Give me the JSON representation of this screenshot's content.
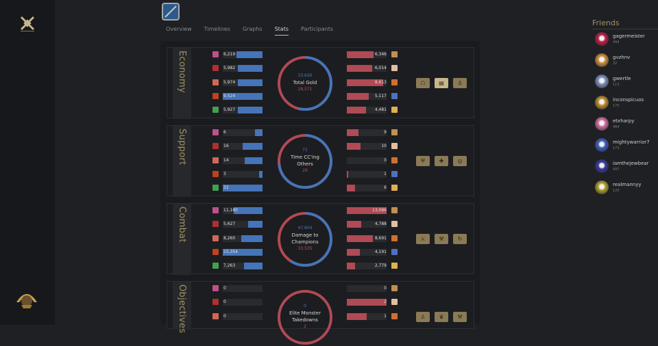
{
  "tabs": [
    {
      "label": "Overview"
    },
    {
      "label": "Timelines"
    },
    {
      "label": "Graphs"
    },
    {
      "label": "Stats",
      "active": true
    },
    {
      "label": "Participants"
    }
  ],
  "colors": {
    "blue": "#4574b8",
    "red": "#b04a55",
    "gold": "#8a7a55"
  },
  "left_champs": [
    "#c0508a",
    "#b03030",
    "#d06858",
    "#c04020",
    "#40a050"
  ],
  "right_champs": [
    "#c09050",
    "#e0c0a0",
    "#d07030",
    "#5070c0",
    "#e0b050"
  ],
  "sections": [
    {
      "name": "Economy",
      "center": {
        "blue": "33,626",
        "label1": "Total Gold",
        "label2": "",
        "red": "28,571"
      },
      "blue_frac": 0.54,
      "left": [
        {
          "value": "6,219",
          "pct": 0.65
        },
        {
          "value": "5,982",
          "pct": 0.62
        },
        {
          "value": "5,974",
          "pct": 0.62
        },
        {
          "value": "9,524",
          "pct": 1.0
        },
        {
          "value": "5,927",
          "pct": 0.62
        }
      ],
      "right": [
        {
          "value": "6,346",
          "pct": 0.68
        },
        {
          "value": "6,014",
          "pct": 0.64
        },
        {
          "value": "8,613",
          "pct": 0.92
        },
        {
          "value": "5,117",
          "pct": 0.55
        },
        {
          "value": "4,481",
          "pct": 0.48
        }
      ],
      "buttons": [
        {
          "icon": "☖",
          "on": false
        },
        {
          "icon": "▤",
          "on": true
        },
        {
          "icon": "⚓",
          "on": false
        }
      ]
    },
    {
      "name": "Support",
      "center": {
        "blue": "71",
        "label1": "Time CC'ing",
        "label2": "Others",
        "red": "26"
      },
      "blue_frac": 0.73,
      "left": [
        {
          "value": "6",
          "pct": 0.19
        },
        {
          "value": "16",
          "pct": 0.5
        },
        {
          "value": "14",
          "pct": 0.44
        },
        {
          "value": "3",
          "pct": 0.09
        },
        {
          "value": "32",
          "pct": 1.0
        }
      ],
      "right": [
        {
          "value": "9",
          "pct": 0.3
        },
        {
          "value": "10",
          "pct": 0.34
        },
        {
          "value": "0",
          "pct": 0.0
        },
        {
          "value": "1",
          "pct": 0.04
        },
        {
          "value": "6",
          "pct": 0.2
        }
      ],
      "buttons": [
        {
          "icon": "⛨",
          "on": false
        },
        {
          "icon": "✚",
          "on": false
        },
        {
          "icon": "◎",
          "on": false
        }
      ]
    },
    {
      "name": "Combat",
      "center": {
        "blue": "47,604",
        "label1": "Damage to",
        "label2": "Champions",
        "red": "33,535"
      },
      "blue_frac": 0.59,
      "left": [
        {
          "value": "11,180",
          "pct": 0.73
        },
        {
          "value": "5,627",
          "pct": 0.37
        },
        {
          "value": "8,260",
          "pct": 0.54
        },
        {
          "value": "15,354",
          "pct": 1.0
        },
        {
          "value": "7,263",
          "pct": 0.47
        }
      ],
      "right": [
        {
          "value": "13,086",
          "pct": 1.0
        },
        {
          "value": "4,788",
          "pct": 0.37
        },
        {
          "value": "8,691",
          "pct": 0.66
        },
        {
          "value": "4,191",
          "pct": 0.32
        },
        {
          "value": "2,779",
          "pct": 0.21
        }
      ],
      "buttons": [
        {
          "icon": "⚔",
          "on": false
        },
        {
          "icon": "⚒",
          "on": false
        },
        {
          "icon": "↻",
          "on": false
        }
      ]
    },
    {
      "name": "Objectives",
      "center": {
        "blue": "0",
        "label1": "Elite Monster",
        "label2": "Takedowns",
        "red": "2"
      },
      "blue_frac": 0.0,
      "left": [
        {
          "value": "0",
          "pct": 0
        },
        {
          "value": "0",
          "pct": 0
        },
        {
          "value": "0",
          "pct": 0
        }
      ],
      "right": [
        {
          "value": "0",
          "pct": 0
        },
        {
          "value": "2",
          "pct": 1.0
        },
        {
          "value": "1",
          "pct": 0.5
        }
      ],
      "buttons": [
        {
          "icon": "♙",
          "on": false
        },
        {
          "icon": "♛",
          "on": false
        },
        {
          "icon": "⚒",
          "on": false
        }
      ]
    }
  ],
  "friends": {
    "title": "Friends",
    "list": [
      {
        "name": "gagermeister",
        "num": "494",
        "color": "#c0204a"
      },
      {
        "name": "gvzhnv",
        "num": "32",
        "color": "#d09040"
      },
      {
        "name": "gwertle",
        "num": "113",
        "color": "#8090c0"
      },
      {
        "name": "inconspicuos",
        "num": "175",
        "color": "#c09030"
      },
      {
        "name": "etxharpy",
        "num": "484",
        "color": "#d070a0"
      },
      {
        "name": "mightywarrior7",
        "num": "173",
        "color": "#4060c0"
      },
      {
        "name": "iamthejewbear",
        "num": "497",
        "color": "#3a3a9a"
      },
      {
        "name": "realmannyy",
        "num": "120",
        "color": "#b0a030"
      }
    ]
  }
}
